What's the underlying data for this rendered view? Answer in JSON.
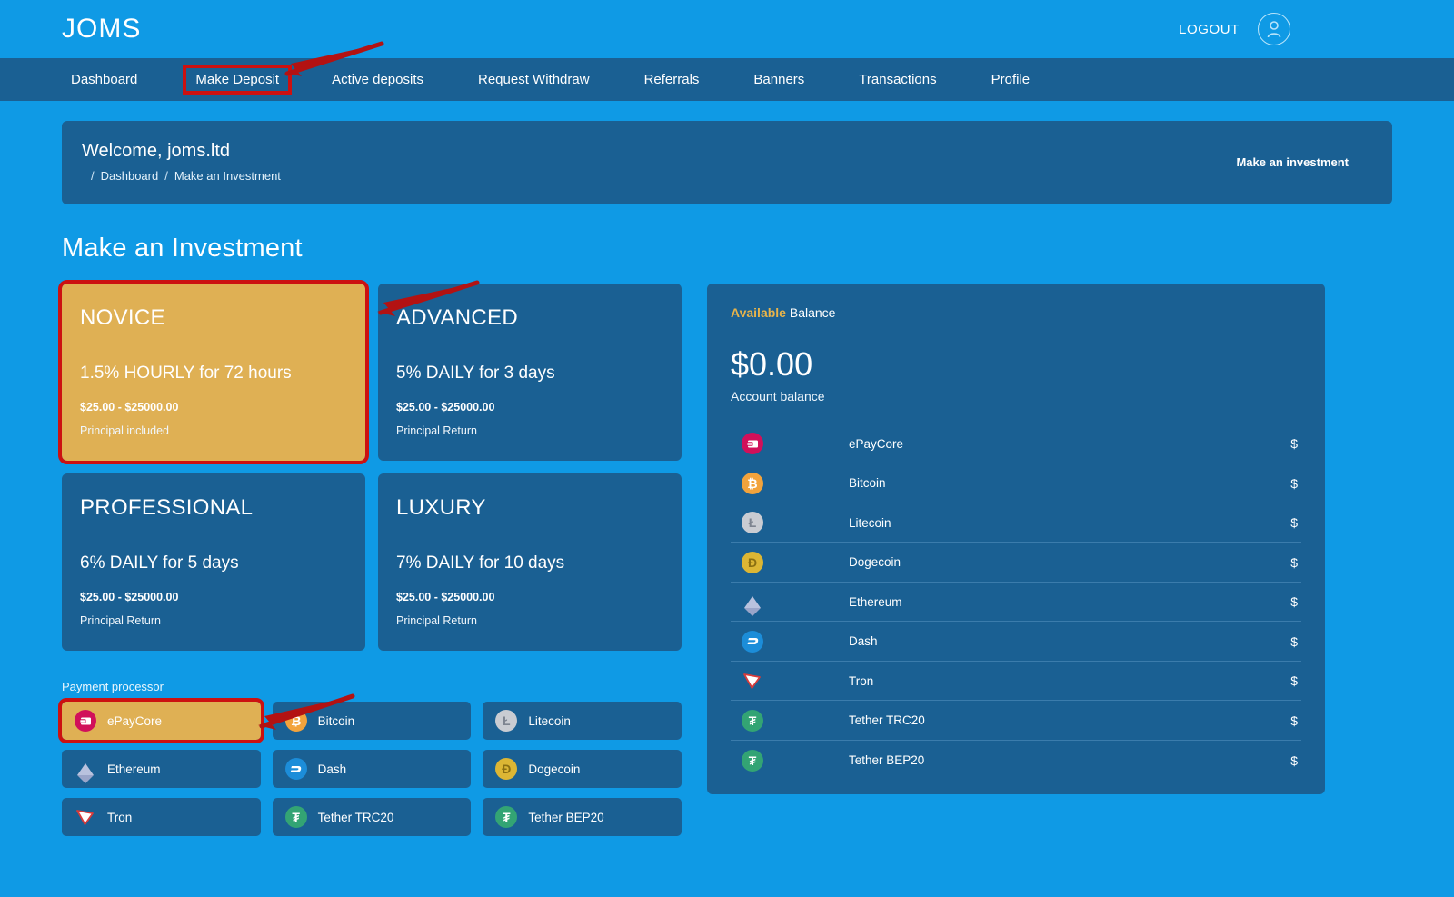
{
  "header": {
    "brand": "JOMS",
    "logout_label": "LOGOUT",
    "avatar_icon": "user-avatar-icon"
  },
  "nav": {
    "items": [
      {
        "label": "Dashboard",
        "highlighted": false
      },
      {
        "label": "Make Deposit",
        "highlighted": true
      },
      {
        "label": "Active deposits",
        "highlighted": false
      },
      {
        "label": "Request Withdraw",
        "highlighted": false
      },
      {
        "label": "Referrals",
        "highlighted": false
      },
      {
        "label": "Banners",
        "highlighted": false
      },
      {
        "label": "Transactions",
        "highlighted": false
      },
      {
        "label": "Profile",
        "highlighted": false
      }
    ]
  },
  "welcome": {
    "title": "Welcome, joms.ltd",
    "breadcrumb": [
      "Dashboard",
      "Make an Investment"
    ],
    "action_label": "Make an investment"
  },
  "page": {
    "title": "Make an Investment"
  },
  "plans": [
    {
      "name": "NOVICE",
      "rate": "1.5% HOURLY for 72 hours",
      "range": "$25.00 - $25000.00",
      "principal": "Principal included",
      "selected": true
    },
    {
      "name": "ADVANCED",
      "rate": "5% DAILY for 3 days",
      "range": "$25.00 - $25000.00",
      "principal": "Principal Return",
      "selected": false
    },
    {
      "name": "PROFESSIONAL",
      "rate": "6% DAILY for 5 days",
      "range": "$25.00 - $25000.00",
      "principal": "Principal Return",
      "selected": false
    },
    {
      "name": "LUXURY",
      "rate": "7% DAILY for 10 days",
      "range": "$25.00 - $25000.00",
      "principal": "Principal Return",
      "selected": false
    }
  ],
  "payment_processor": {
    "label": "Payment processor",
    "options": [
      {
        "name": "ePayCore",
        "icon": "epaycore-icon",
        "selected": true
      },
      {
        "name": "Bitcoin",
        "icon": "bitcoin-icon",
        "selected": false
      },
      {
        "name": "Litecoin",
        "icon": "litecoin-icon",
        "selected": false
      },
      {
        "name": "Ethereum",
        "icon": "ethereum-icon",
        "selected": false
      },
      {
        "name": "Dash",
        "icon": "dash-icon",
        "selected": false
      },
      {
        "name": "Dogecoin",
        "icon": "dogecoin-icon",
        "selected": false
      },
      {
        "name": "Tron",
        "icon": "tron-icon",
        "selected": false
      },
      {
        "name": "Tether TRC20",
        "icon": "tether-icon",
        "selected": false
      },
      {
        "name": "Tether BEP20",
        "icon": "tether-icon",
        "selected": false
      }
    ]
  },
  "balance": {
    "head_accent": "Available",
    "head_rest": " Balance",
    "amount": "$0.00",
    "subtitle": "Account balance",
    "rows": [
      {
        "name": "ePayCore",
        "value": "$",
        "icon": "epaycore-icon"
      },
      {
        "name": "Bitcoin",
        "value": "$",
        "icon": "bitcoin-icon"
      },
      {
        "name": "Litecoin",
        "value": "$",
        "icon": "litecoin-icon"
      },
      {
        "name": "Dogecoin",
        "value": "$",
        "icon": "dogecoin-icon"
      },
      {
        "name": "Ethereum",
        "value": "$",
        "icon": "ethereum-icon"
      },
      {
        "name": "Dash",
        "value": "$",
        "icon": "dash-icon"
      },
      {
        "name": "Tron",
        "value": "$",
        "icon": "tron-icon"
      },
      {
        "name": "Tether TRC20",
        "value": "$",
        "icon": "tether-icon"
      },
      {
        "name": "Tether BEP20",
        "value": "$",
        "icon": "tether-icon"
      }
    ]
  },
  "colors": {
    "page_background": "#0f9ae5",
    "panel": "#1a6093",
    "selected_gold": "#dfb054",
    "annotation_red": "#cc1111",
    "accent_gold_text": "#e8b44a"
  }
}
